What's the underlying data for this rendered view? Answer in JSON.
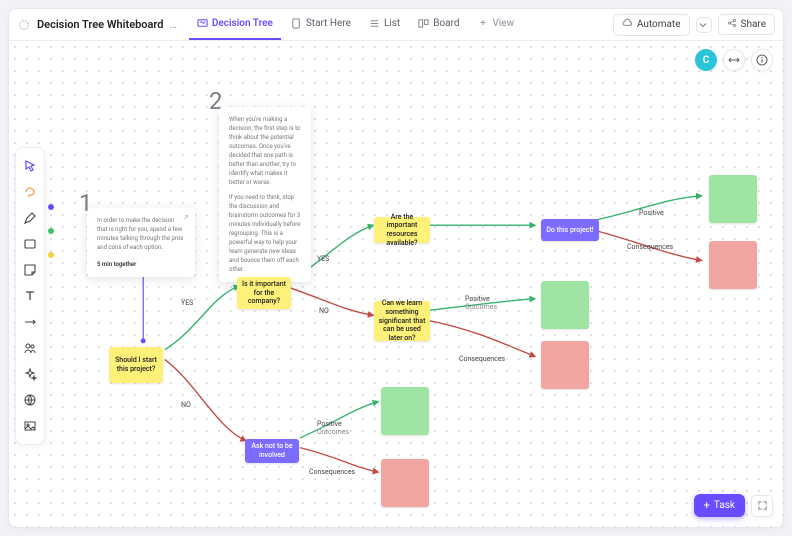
{
  "header": {
    "title": "Decision Tree Whiteboard",
    "tabs": {
      "decision_tree": "Decision Tree",
      "start_here": "Start Here",
      "list": "List",
      "board": "Board",
      "add_view": "View"
    },
    "automate": "Automate",
    "share": "Share"
  },
  "avatar": "C",
  "guide": {
    "num1": "1",
    "num2": "2",
    "card1_body": "In order to make the decision that is right for you, spend a few minutes talking through the pros and cons of each option.",
    "card1_footer": "5 min together",
    "card2_p1": "When you're making a decision, the first step is to think about the potential outcomes. Once you've decided that one path is better than another, try to identify what makes it better or worse.",
    "card2_p2": "If you need to think, stop the discussion and brainstorm outcomes for 3 minutes individually before regrouping. This is a powerful way to help your team generate new ideas and bounce them off each other."
  },
  "nodes": {
    "start": "Should I start this project?",
    "important": "Is it important for the company?",
    "resources": "Are the important resources available?",
    "do_project": "Do this project!",
    "learn": "Can we learn something significant that can be used later on?",
    "ask_not": "Ask not to be involved"
  },
  "labels": {
    "yes": "YES",
    "no": "NO",
    "positive": "Positive",
    "outcomes_sub": "Outcomes",
    "consequences": "Consequences",
    "positive_outcomes": "Positive\nOutcomes"
  },
  "task_button": "Task"
}
